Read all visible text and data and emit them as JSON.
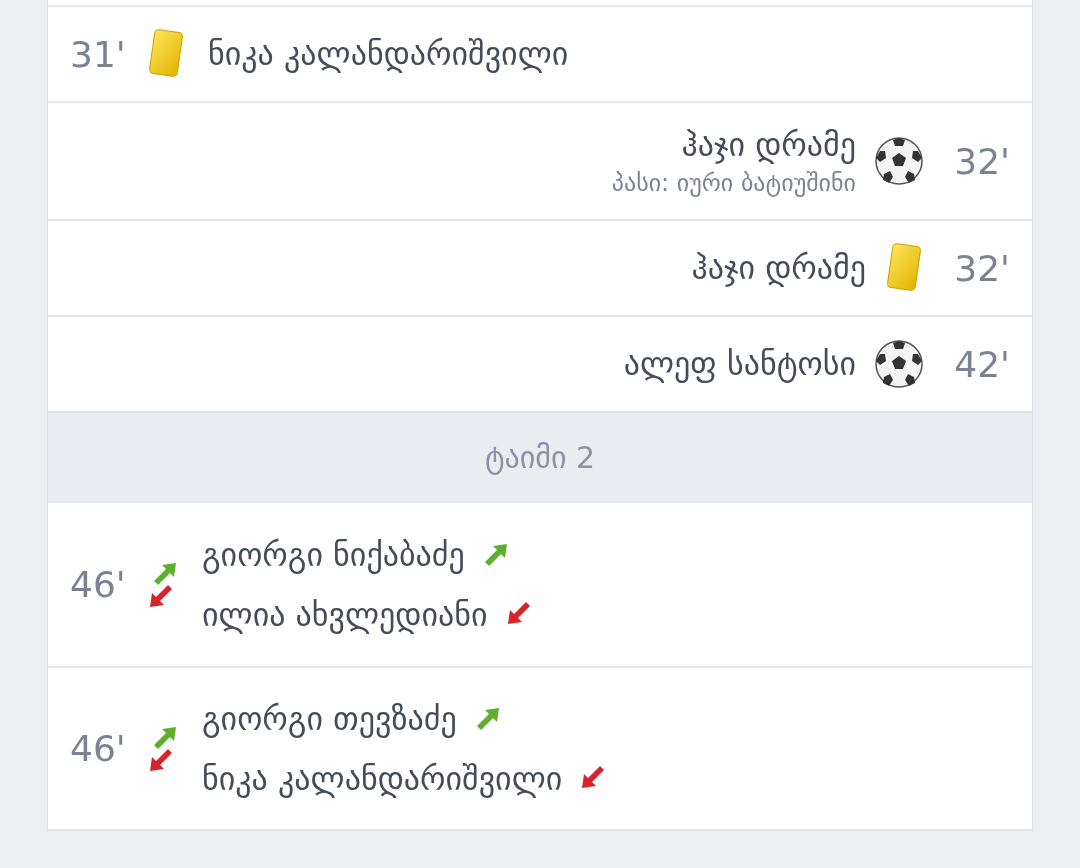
{
  "events": [
    {
      "kind": "yellow_card",
      "away": false,
      "minute": "31'",
      "player": "ნიკა კალანდარიშვილი"
    },
    {
      "kind": "goal",
      "away": true,
      "minute": "32'",
      "player": "ჰაჯი დრამე",
      "assist": "პასი: იური ბატიუშინი"
    },
    {
      "kind": "yellow_card",
      "away": true,
      "minute": "32'",
      "player": "ჰაჯი დრამე"
    },
    {
      "kind": "goal",
      "away": true,
      "minute": "42'",
      "player": "ალეფ სანტოსი"
    },
    {
      "kind": "period",
      "label": "ტაიმი 2"
    },
    {
      "kind": "substitution",
      "away": false,
      "minute": "46'",
      "player_in": "გიორგი ნიქაბაძე",
      "player_out": "ილია ახვლედიანი"
    },
    {
      "kind": "substitution",
      "away": false,
      "minute": "46'",
      "player_in": "გიორგი თევზაძე",
      "player_out": "ნიკა კალანდარიშვილი"
    }
  ]
}
